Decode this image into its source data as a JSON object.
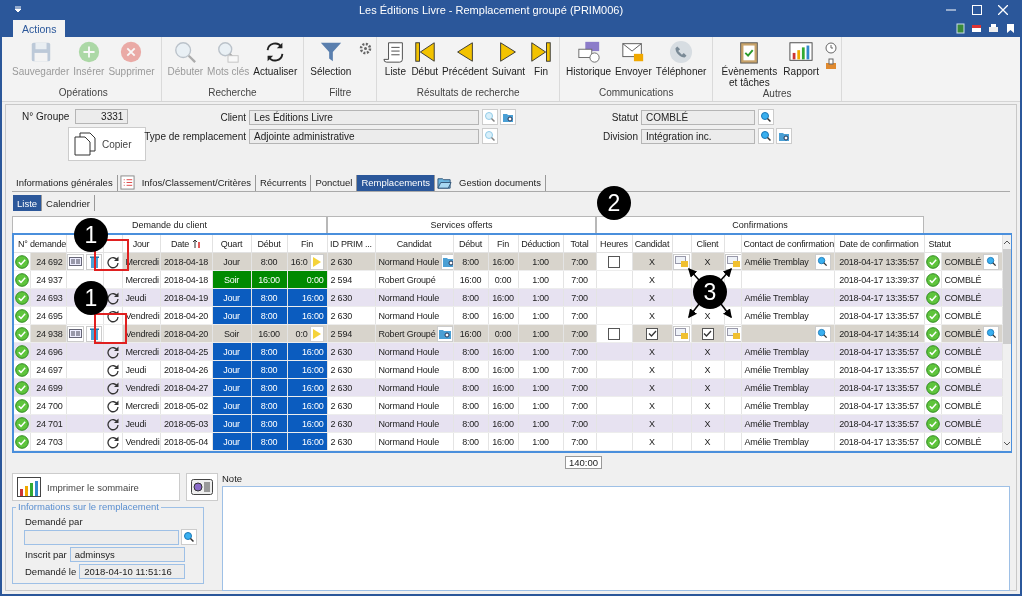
{
  "window": {
    "title": "Les Éditions Livre - Remplacement groupé (PRIM006)"
  },
  "ribbon": {
    "tabs": [
      {
        "label": "Actions",
        "selected": true
      }
    ],
    "groups": [
      {
        "name": "Opérations",
        "buttons": [
          {
            "label": "Sauvegarder",
            "disabled": true
          },
          {
            "label": "Insérer",
            "disabled": true
          },
          {
            "label": "Supprimer",
            "disabled": true
          }
        ]
      },
      {
        "name": "Recherche",
        "buttons": [
          {
            "label": "Débuter",
            "disabled": true
          },
          {
            "label": "Mots clés",
            "disabled": true
          },
          {
            "label": "Actualiser",
            "disabled": false
          }
        ]
      },
      {
        "name": "Filtre",
        "buttons": [
          {
            "label": "Sélection",
            "disabled": false
          }
        ]
      },
      {
        "name": "Résultats de recherche",
        "buttons": [
          {
            "label": "Liste",
            "disabled": false
          },
          {
            "label": "Début",
            "disabled": false
          },
          {
            "label": "Précédent",
            "disabled": false
          },
          {
            "label": "Suivant",
            "disabled": false
          },
          {
            "label": "Fin",
            "disabled": false
          }
        ]
      },
      {
        "name": "Communications",
        "buttons": [
          {
            "label": "Historique",
            "disabled": false
          },
          {
            "label": "Envoyer",
            "disabled": false
          },
          {
            "label": "Téléphoner",
            "disabled": false
          }
        ]
      },
      {
        "name": "Autres",
        "buttons": [
          {
            "label": "Évènements et tâches",
            "disabled": false
          },
          {
            "label": "Rapport",
            "disabled": false
          }
        ]
      }
    ]
  },
  "form": {
    "group": {
      "label": "N° Groupe",
      "value": "3331"
    },
    "copy_button": "Copier",
    "client": {
      "label": "Client",
      "value": "Les Éditions Livre"
    },
    "replacement_type": {
      "label": "Type de remplacement",
      "value": "Adjointe administrative"
    },
    "status": {
      "label": "Statut",
      "value": "COMBLÉ"
    },
    "division": {
      "label": "Division",
      "value": "Intégration inc."
    }
  },
  "tabs": [
    {
      "label": "Informations générales",
      "selected": false
    },
    {
      "label": "Infos/Classement/Critères",
      "selected": false
    },
    {
      "label": "Récurrents",
      "selected": false
    },
    {
      "label": "Ponctuel",
      "selected": false
    },
    {
      "label": "Remplacements",
      "selected": true
    },
    {
      "label": "Gestion documents",
      "selected": false
    }
  ],
  "subtabs": [
    {
      "label": "Liste",
      "selected": true
    },
    {
      "label": "Calendrier",
      "selected": false
    }
  ],
  "table": {
    "groups": [
      "Demande du client",
      "Services offerts",
      "Confirmations"
    ],
    "columns": [
      "N° demande",
      "Jour",
      "Date",
      "Quart",
      "Début",
      "Fin",
      "ID PRIM ...",
      "Candidat",
      "Début",
      "Fin",
      "Déduction",
      "Total",
      "Heures",
      "Candidat",
      "Client",
      "Contact de confirmation",
      "Date de confirmation",
      "Statut"
    ],
    "rows": [
      {
        "kind": "edit",
        "id": "24 692",
        "refresh": true,
        "day": "Mercredi",
        "date": "2018-04-18",
        "shift": "Jour",
        "start": "8:00",
        "end": "16:0",
        "prim_id": "2 630",
        "candidate": "Normand Houle",
        "s_start": "8:00",
        "s_end": "16:00",
        "deduction": "1:00",
        "total": "7:00",
        "hours_checked": false,
        "candidate_confirm": "X",
        "client_confirm": "X",
        "contact": "Amélie Tremblay",
        "conf_date": "2018-04-17 13:35:57",
        "status": "COMBLÉ"
      },
      {
        "kind": "normal",
        "shaded": false,
        "id": "24 937",
        "refresh": false,
        "day": "Mercredi",
        "date": "2018-04-18",
        "shift": "Soir",
        "color": "#008a00",
        "start": "16:00",
        "end": "0:00",
        "prim_id": "2 594",
        "candidate": "Robert Groupé",
        "s_start": "16:00",
        "s_end": "0:00",
        "deduction": "1:00",
        "total": "7:00",
        "candidate_confirm": "X",
        "conf_date": "2018-04-17 13:39:37",
        "status": "COMBLÉ"
      },
      {
        "kind": "normal",
        "shaded": true,
        "id": "24 693",
        "refresh": true,
        "day": "Jeudi",
        "date": "2018-04-19",
        "shift": "Jour",
        "color": "#0b5cbf",
        "start": "8:00",
        "end": "16:00",
        "prim_id": "2 630",
        "candidate": "Normand Houle",
        "s_start": "8:00",
        "s_end": "16:00",
        "deduction": "1:00",
        "total": "7:00",
        "candidate_confirm": "X",
        "contact": "Amélie Tremblay",
        "conf_date": "2018-04-17 13:35:57",
        "status": "COMBLÉ"
      },
      {
        "kind": "normal",
        "shaded": false,
        "id": "24 695",
        "refresh": true,
        "day": "Vendredi",
        "date": "2018-04-20",
        "shift": "Jour",
        "color": "#0b5cbf",
        "start": "8:00",
        "end": "16:00",
        "prim_id": "2 630",
        "candidate": "Normand Houle",
        "s_start": "8:00",
        "s_end": "16:00",
        "deduction": "1:00",
        "total": "7:00",
        "candidate_confirm": "X",
        "client_confirm": "X",
        "contact": "Amélie Tremblay",
        "conf_date": "2018-04-17 13:35:57",
        "status": "COMBLÉ"
      },
      {
        "kind": "edit",
        "id": "24 938",
        "refresh": false,
        "day": "Vendredi",
        "date": "2018-04-20",
        "shift": "Soir",
        "start": "16:00",
        "end": "0:0",
        "prim_id": "2 594",
        "candidate": "Robert Groupé",
        "s_start": "16:00",
        "s_end": "0:00",
        "deduction": "1:00",
        "total": "7:00",
        "hours_checked": false,
        "candidate_checked": true,
        "client_checked": true,
        "conf_date": "2018-04-17 14:35:14",
        "status": "COMBLÉ"
      },
      {
        "kind": "normal",
        "shaded": true,
        "id": "24 696",
        "refresh": true,
        "day": "Mercredi",
        "date": "2018-04-25",
        "shift": "Jour",
        "color": "#0b5cbf",
        "start": "8:00",
        "end": "16:00",
        "prim_id": "2 630",
        "candidate": "Normand Houle",
        "s_start": "8:00",
        "s_end": "16:00",
        "deduction": "1:00",
        "total": "7:00",
        "candidate_confirm": "X",
        "client_confirm": "X",
        "contact": "Amélie Tremblay",
        "conf_date": "2018-04-17 13:35:57",
        "status": "COMBLÉ"
      },
      {
        "kind": "normal",
        "shaded": false,
        "id": "24 697",
        "refresh": true,
        "day": "Jeudi",
        "date": "2018-04-26",
        "shift": "Jour",
        "color": "#0b5cbf",
        "start": "8:00",
        "end": "16:00",
        "prim_id": "2 630",
        "candidate": "Normand Houle",
        "s_start": "8:00",
        "s_end": "16:00",
        "deduction": "1:00",
        "total": "7:00",
        "candidate_confirm": "X",
        "client_confirm": "X",
        "contact": "Amélie Tremblay",
        "conf_date": "2018-04-17 13:35:57",
        "status": "COMBLÉ"
      },
      {
        "kind": "normal",
        "shaded": true,
        "id": "24 699",
        "refresh": true,
        "day": "Vendredi",
        "date": "2018-04-27",
        "shift": "Jour",
        "color": "#0b5cbf",
        "start": "8:00",
        "end": "16:00",
        "prim_id": "2 630",
        "candidate": "Normand Houle",
        "s_start": "8:00",
        "s_end": "16:00",
        "deduction": "1:00",
        "total": "7:00",
        "candidate_confirm": "X",
        "client_confirm": "X",
        "contact": "Amélie Tremblay",
        "conf_date": "2018-04-17 13:35:57",
        "status": "COMBLÉ"
      },
      {
        "kind": "normal",
        "shaded": false,
        "id": "24 700",
        "refresh": true,
        "day": "Mercredi",
        "date": "2018-05-02",
        "shift": "Jour",
        "color": "#0b5cbf",
        "start": "8:00",
        "end": "16:00",
        "prim_id": "2 630",
        "candidate": "Normand Houle",
        "s_start": "8:00",
        "s_end": "16:00",
        "deduction": "1:00",
        "total": "7:00",
        "candidate_confirm": "X",
        "client_confirm": "X",
        "contact": "Amélie Tremblay",
        "conf_date": "2018-04-17 13:35:57",
        "status": "COMBLÉ"
      },
      {
        "kind": "normal",
        "shaded": true,
        "id": "24 701",
        "refresh": true,
        "day": "Jeudi",
        "date": "2018-05-03",
        "shift": "Jour",
        "color": "#0b5cbf",
        "start": "8:00",
        "end": "16:00",
        "prim_id": "2 630",
        "candidate": "Normand Houle",
        "s_start": "8:00",
        "s_end": "16:00",
        "deduction": "1:00",
        "total": "7:00",
        "candidate_confirm": "X",
        "client_confirm": "X",
        "contact": "Amélie Tremblay",
        "conf_date": "2018-04-17 13:35:57",
        "status": "COMBLÉ"
      },
      {
        "kind": "normal",
        "shaded": false,
        "id": "24 703",
        "refresh": true,
        "day": "Vendredi",
        "date": "2018-05-04",
        "shift": "Jour",
        "color": "#0b5cbf",
        "start": "8:00",
        "end": "16:00",
        "prim_id": "2 630",
        "candidate": "Normand Houle",
        "s_start": "8:00",
        "s_end": "16:00",
        "deduction": "1:00",
        "total": "7:00",
        "candidate_confirm": "X",
        "client_confirm": "X",
        "contact": "Amélie Tremblay",
        "conf_date": "2018-04-17 13:35:57",
        "status": "COMBLÉ"
      }
    ],
    "total": "140:00"
  },
  "summary_button": "Imprimer le sommaire",
  "replacement_info": {
    "legend": "Informations sur le remplacement",
    "requested_by": {
      "label": "Demandé par"
    },
    "entered_by": {
      "label": "Inscrit par",
      "value": "adminsys"
    },
    "requested_on": {
      "label": "Demandé le",
      "value": "2018-04-10 11:51:16"
    }
  },
  "note": {
    "label": "Note"
  },
  "annotations": [
    {
      "label": "1"
    },
    {
      "label": "1"
    },
    {
      "label": "2"
    },
    {
      "label": "3"
    }
  ]
}
